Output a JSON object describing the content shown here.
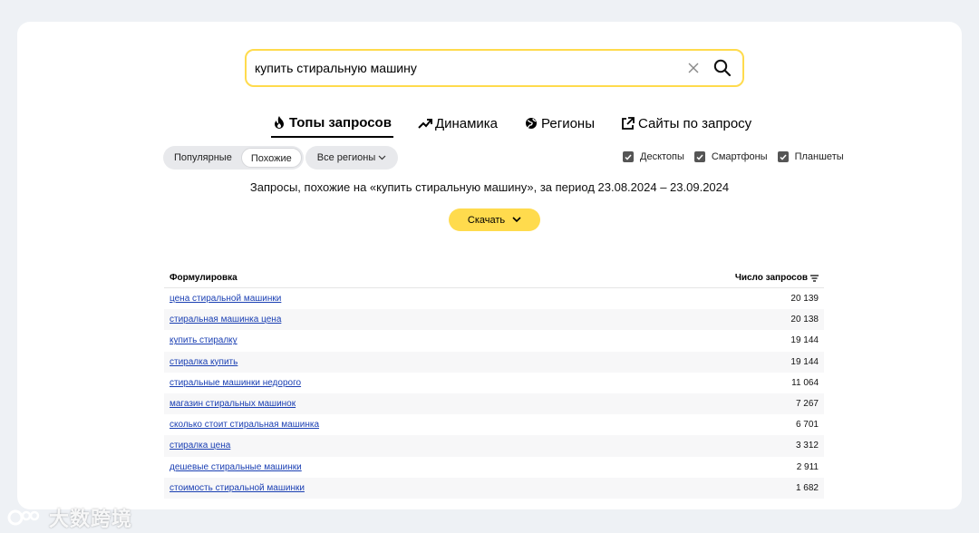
{
  "search": {
    "value": "купить стиральную машину"
  },
  "tabs": [
    {
      "label": "Топы запросов",
      "icon": "flame-icon",
      "active": true
    },
    {
      "label": "Динамика",
      "icon": "trend-icon"
    },
    {
      "label": "Регионы",
      "icon": "globe-icon"
    },
    {
      "label": "Сайты по запросу",
      "icon": "external-link-icon"
    }
  ],
  "segment": {
    "popular": "Популярные",
    "similar": "Похожие"
  },
  "regions_label": "Все регионы",
  "devices": {
    "desktop": "Десктопы",
    "smartphones": "Смартфоны",
    "tablets": "Планшеты"
  },
  "subtitle": "Запросы, похожие на «купить стиральную машину», за период 23.08.2024 – 23.09.2024",
  "download_label": "Скачать",
  "table": {
    "col_phrase": "Формулировка",
    "col_count": "Число запросов",
    "rows": [
      {
        "phrase": "цена стиральной машинки",
        "count": "20 139"
      },
      {
        "phrase": "стиральная машинка цена",
        "count": "20 138"
      },
      {
        "phrase": "купить стиралку",
        "count": "19 144"
      },
      {
        "phrase": "стиралка купить",
        "count": "19 144"
      },
      {
        "phrase": "стиральные машинки недорого",
        "count": "11 064"
      },
      {
        "phrase": "магазин стиральных машинок",
        "count": "7 267"
      },
      {
        "phrase": "сколько стоит стиральная машинка",
        "count": "6 701"
      },
      {
        "phrase": "стиралка цена",
        "count": "3 312"
      },
      {
        "phrase": "дешевые стиральные машинки",
        "count": "2 911"
      },
      {
        "phrase": "стоимость стиральной машинки",
        "count": "1 682"
      }
    ]
  },
  "watermark": "大数跨境",
  "colors": {
    "accent": "#ffdb4d",
    "link": "#1a3fb3"
  }
}
